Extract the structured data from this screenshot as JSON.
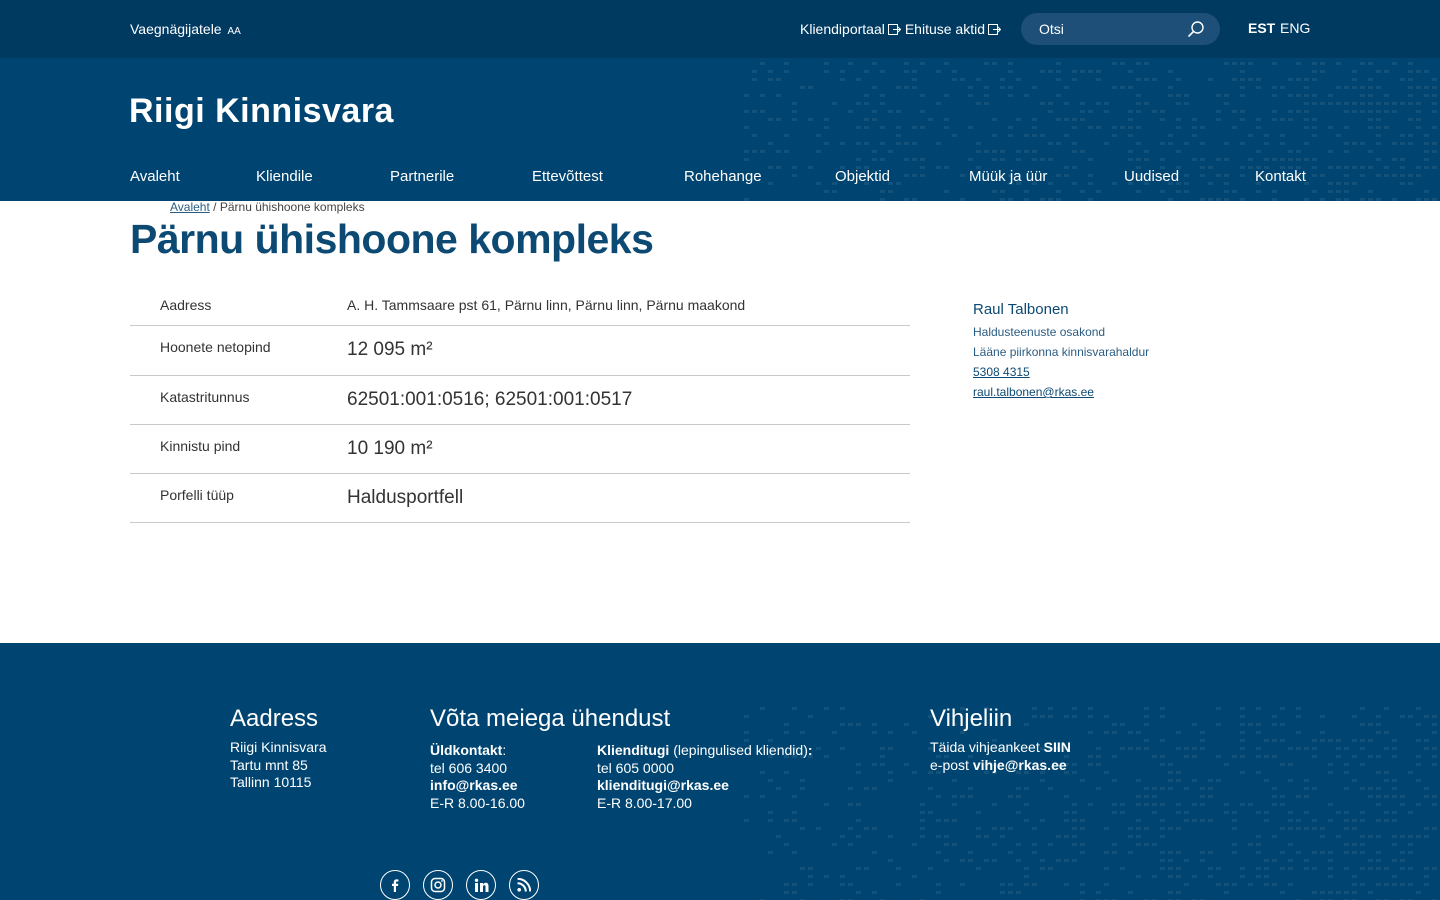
{
  "topbar": {
    "accessibility_label": "Vaegnägijatele",
    "accessibility_suffix": "AA",
    "links": [
      "Kliendiportaal",
      "Ehituse aktid"
    ],
    "search_placeholder": "Otsi",
    "lang_est": "EST",
    "lang_eng": "ENG"
  },
  "header": {
    "logo": "Riigi Kinnisvara",
    "nav": [
      "Avaleht",
      "Kliendile",
      "Partnerile",
      "Ettevõttest",
      "Rohehange",
      "Objektid",
      "Müük ja üür",
      "Uudised",
      "Kontakt"
    ]
  },
  "breadcrumb": {
    "home": "Avaleht",
    "separator": "/",
    "current": "Pärnu ühishoone kompleks"
  },
  "page_title": "Pärnu ühishoone kompleks",
  "info_rows": [
    {
      "label": "Aadress",
      "value": "A. H. Tammsaare pst 61, Pärnu linn, Pärnu linn, Pärnu maakond"
    },
    {
      "label": "Hoonete netopind",
      "value": "12 095 m²"
    },
    {
      "label": "Katastritunnus",
      "value": "62501:001:0516; 62501:001:0517"
    },
    {
      "label": "Kinnistu pind",
      "value": "10 190 m²"
    },
    {
      "label": "Porfelli tüüp",
      "value": "Haldusportfell"
    }
  ],
  "contact": {
    "name": "Raul Talbonen",
    "department": "Haldusteenuste osakond",
    "role": "Lääne piirkonna kinnisvarahaldur",
    "phone": "5308 4315",
    "email": "raul.talbonen@rkas.ee"
  },
  "footer": {
    "address": {
      "heading": "Aadress",
      "lines": [
        "Riigi Kinnisvara",
        "Tartu mnt 85",
        "Tallinn 10115"
      ]
    },
    "contact": {
      "heading": "Võta meiega ühendust",
      "general": {
        "title": "Üldkontakt",
        "colon": ":",
        "phone": "tel 606 3400",
        "email": "info@rkas.ee",
        "hours": "E-R 8.00-16.00"
      },
      "support": {
        "title": "Klienditugi",
        "note": "(lepingulised kliendid)",
        "colon": ":",
        "phone": "tel 605 0000",
        "email": "klienditugi@rkas.ee",
        "hours": "E-R 8.00-17.00"
      }
    },
    "tipline": {
      "heading": "Vihjeliin",
      "line1_prefix": "Täida vihjeankeet",
      "line1_link": "SIIN",
      "line2_prefix": "e-post",
      "line2_link": "vihje@rkas.ee"
    },
    "social": [
      "facebook-icon",
      "instagram-icon",
      "linkedin-icon",
      "rss-icon"
    ]
  },
  "colors": {
    "topbar": "#003a61",
    "header": "#004571",
    "title": "#0d4a73",
    "search": "#1d4f78"
  }
}
